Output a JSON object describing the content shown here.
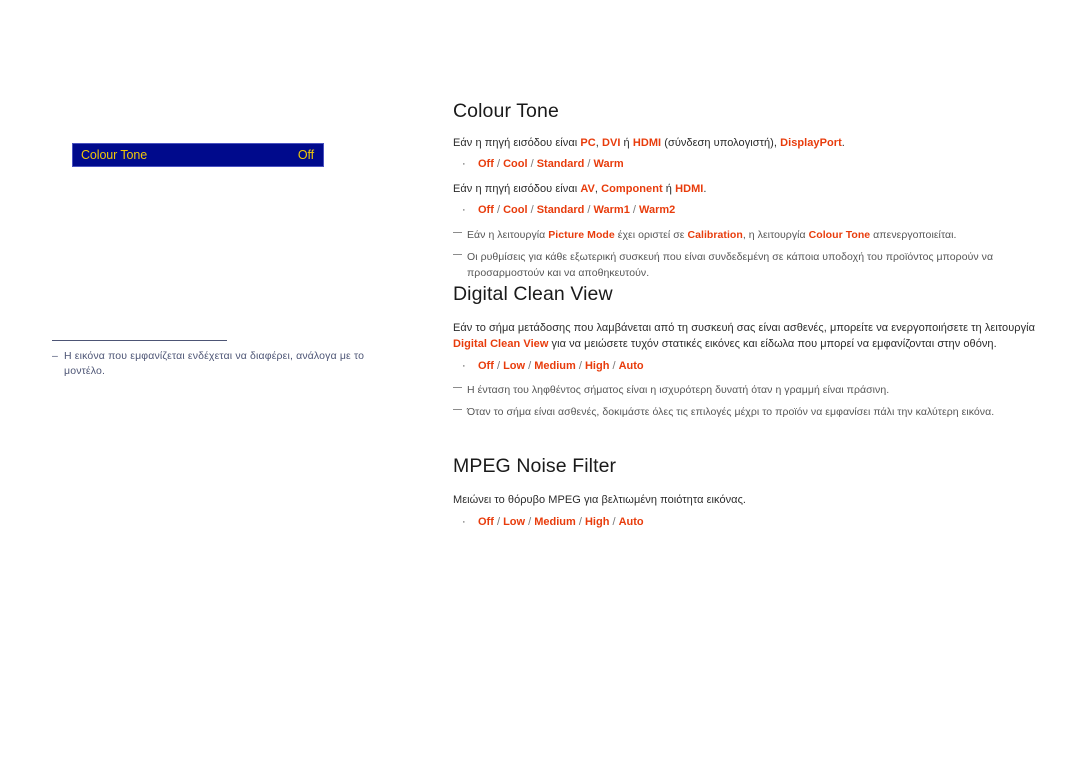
{
  "page": {
    "background": "#ffffff",
    "accent_keyword_color": "#e83c0c",
    "osd_bg_color": "#000a8c",
    "osd_text_color": "#f0c808",
    "note_color": "#4d5575"
  },
  "left": {
    "osd": {
      "label": "Colour Tone",
      "value": "Off"
    },
    "note": {
      "dash": "–",
      "text": "Η εικόνα που εμφανίζεται ενδέχεται να διαφέρει, ανάλογα με το μοντέλο."
    }
  },
  "sections": [
    {
      "id": "colour-tone",
      "heading": "Colour Tone",
      "intro_1": {
        "prefix": "Εάν η πηγή εισόδου είναι ",
        "kw1": "PC",
        "mid1": ", ",
        "kw2": "DVI",
        "mid2": " ή ",
        "kw3": "HDMI",
        "mid3": " (σύνδεση υπολογιστή), ",
        "kw4": "DisplayPort",
        "suffix": "."
      },
      "options_1": {
        "bullet": "·",
        "items": [
          "Off",
          "Cool",
          "Standard",
          "Warm"
        ],
        "separator": " / "
      },
      "intro_2": {
        "prefix": "Εάν η πηγή εισόδου είναι ",
        "kw1": "AV",
        "mid1": ", ",
        "kw2": "Component",
        "mid2": "  ή ",
        "kw3": "HDMI",
        "suffix": "."
      },
      "options_2": {
        "bullet": "·",
        "items": [
          "Off",
          "Cool",
          "Standard",
          "Warm1",
          "Warm2"
        ],
        "separator": " / "
      },
      "notes": [
        {
          "p1": "Εάν η λειτουργία ",
          "k1": "Picture Mode",
          "p2": " έχει οριστεί σε ",
          "k2": "Calibration",
          "p3": ", η λειτουργία ",
          "k3": "Colour Tone",
          "p4": " απενεργοποιείται."
        },
        {
          "p1": "Οι ρυθμίσεις για κάθε εξωτερική συσκευή που είναι συνδεδεμένη σε κάποια υποδοχή του προϊόντος μπορούν να προσαρμοστούν και να αποθηκευτούν.",
          "k1": "",
          "p2": "",
          "k2": "",
          "p3": "",
          "k3": "",
          "p4": ""
        }
      ]
    },
    {
      "id": "digital-clean-view",
      "heading": "Digital Clean View",
      "intro": {
        "p1": "Εάν το σήμα μετάδοσης που λαμβάνεται από τη συσκευή σας είναι ασθενές, μπορείτε να ενεργοποιήσετε τη λειτουργία ",
        "k1": "Digital Clean View",
        "p2": " για να μειώσετε τυχόν στατικές εικόνες και είδωλα που μπορεί να εμφανίζονται στην οθόνη."
      },
      "options": {
        "bullet": "·",
        "items": [
          "Off",
          "Low",
          "Medium",
          "High",
          "Auto"
        ],
        "separator": " / "
      },
      "notes": [
        {
          "text": "Η ένταση του ληφθέντος σήματος είναι η ισχυρότερη δυνατή όταν η γραμμή είναι πράσινη."
        },
        {
          "text": "Όταν το σήμα είναι ασθενές, δοκιμάστε όλες τις επιλογές μέχρι το προϊόν να εμφανίσει πάλι την καλύτερη εικόνα."
        }
      ]
    },
    {
      "id": "mpeg-noise-filter",
      "heading": "MPEG Noise Filter",
      "intro": {
        "p1": "Μειώνει το θόρυβο MPEG για βελτιωμένη ποιότητα εικόνας.",
        "k1": "",
        "p2": ""
      },
      "options": {
        "bullet": "·",
        "items": [
          "Off",
          "Low",
          "Medium",
          "High",
          "Auto"
        ],
        "separator": " / "
      },
      "notes": []
    }
  ]
}
